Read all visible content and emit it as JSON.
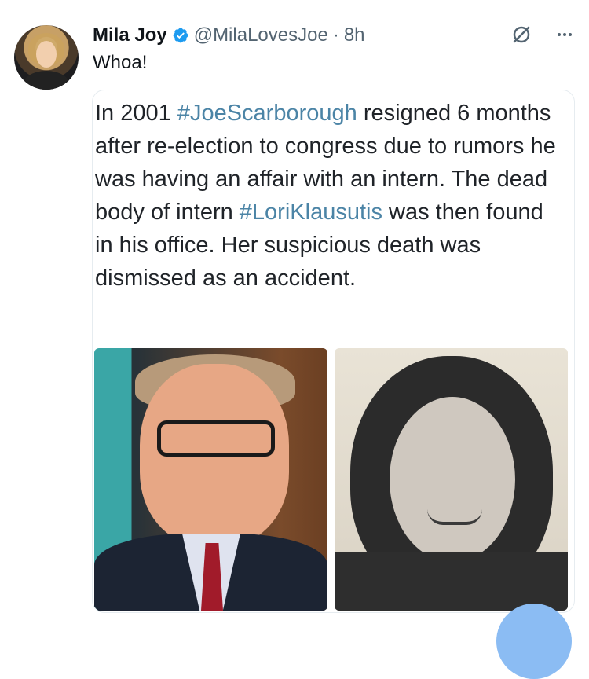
{
  "tweet": {
    "author_name": "Mila Joy",
    "handle": "@MilaLovesJoe",
    "separator": "·",
    "time": "8h",
    "text": "Whoa!",
    "verified_icon": "verified-badge-icon",
    "grok_icon": "grok-icon",
    "more_icon": "more-icon",
    "accent_color": "#1d9bf0"
  },
  "media_card": {
    "text_segments": [
      "In 2001 ",
      "#JoeScarborough",
      " resigned 6 months after re-election to congress due to rumors he was having an affair with an intern. The dead body of intern ",
      "#LoriKlausutis",
      " was then found in his office. Her suspicious death was dismissed as an accident."
    ],
    "hashtag_color": "#4b84a6",
    "images": [
      {
        "name": "man-photo"
      },
      {
        "name": "woman-photo"
      }
    ]
  }
}
